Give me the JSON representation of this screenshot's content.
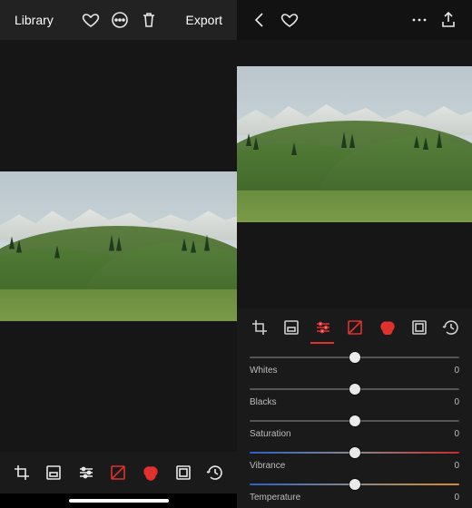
{
  "left": {
    "library_label": "Library",
    "export_label": "Export"
  },
  "right": {
    "sliders": [
      {
        "label": "Whites",
        "value": "0",
        "pos": 50,
        "variant": "plain"
      },
      {
        "label": "Blacks",
        "value": "0",
        "pos": 50,
        "variant": "plain"
      },
      {
        "label": "Saturation",
        "value": "0",
        "pos": 50,
        "variant": "plain"
      },
      {
        "label": "Vibrance",
        "value": "0",
        "pos": 50,
        "variant": "vib"
      },
      {
        "label": "Temperature",
        "value": "0",
        "pos": 50,
        "variant": "temp"
      }
    ]
  },
  "tools": {
    "active_index": 2,
    "red_index": 3
  },
  "icons": {
    "heart": "heart-icon",
    "more": "more-icon",
    "trash": "trash-icon",
    "back": "chevron-left-icon",
    "share": "share-icon",
    "crop": "crop-icon",
    "preset": "preset-icon",
    "adjust": "adjust-icon",
    "curves": "curves-icon",
    "color": "color-wheel-icon",
    "frame": "frame-icon",
    "history": "history-icon"
  }
}
